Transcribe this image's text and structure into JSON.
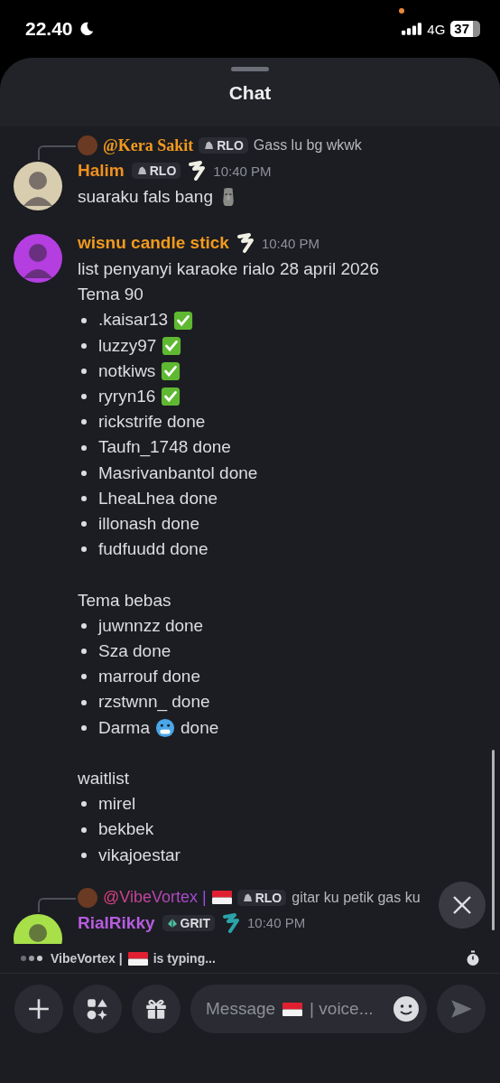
{
  "status_bar": {
    "time": "22.40",
    "network": "4G",
    "battery": "37"
  },
  "header": {
    "title": "Chat"
  },
  "messages": [
    {
      "reply": {
        "author": "@Kera Sakit",
        "flag": false,
        "tag": {
          "label": "RLO",
          "kind": "rock"
        },
        "text": "Gass lu bg wkwk"
      },
      "author": "Halim",
      "color": "#f0901e",
      "avatar": {
        "color": "#d9cdb0"
      },
      "tag": {
        "label": "RLO",
        "kind": "rock"
      },
      "badge": {
        "color": "#f0efe4"
      },
      "time": "10:40 PM",
      "body": [
        {
          "kind": "line",
          "text": "suaraku fals bang",
          "emoji": {
            "kind": "moai"
          }
        }
      ]
    },
    {
      "author": "wisnu candle stick",
      "color": "#f29a1d",
      "avatar": {
        "color": "#b43ee0"
      },
      "badge": {
        "color": "#f0efe4"
      },
      "time": "10:40 PM",
      "body": [
        {
          "kind": "line",
          "text": "list penyanyi karaoke rialo 28 april 2026"
        },
        {
          "kind": "line",
          "text": "Tema 90"
        },
        {
          "kind": "bullet",
          "text": ".kaisar13",
          "checked": true
        },
        {
          "kind": "bullet",
          "text": "luzzy97",
          "checked": true
        },
        {
          "kind": "bullet",
          "text": "notkiws",
          "checked": true
        },
        {
          "kind": "bullet",
          "text": "ryryn16",
          "checked": true
        },
        {
          "kind": "bullet",
          "text": "rickstrife  done",
          "checked": false
        },
        {
          "kind": "bullet",
          "text": "Taufn_1748  done",
          "checked": false
        },
        {
          "kind": "bullet",
          "text": "Masrivanbantol done",
          "checked": false
        },
        {
          "kind": "bullet",
          "text": "LheaLhea done",
          "checked": false
        },
        {
          "kind": "bullet",
          "text": "illonash done",
          "checked": false
        },
        {
          "kind": "bullet",
          "text": "fudfuudd done",
          "checked": false
        },
        {
          "kind": "gap"
        },
        {
          "kind": "line",
          "text": "Tema bebas"
        },
        {
          "kind": "bullet",
          "text": "juwnnzz done",
          "checked": false
        },
        {
          "kind": "bullet",
          "text": "Sza done",
          "checked": false
        },
        {
          "kind": "bullet",
          "text": "marrouf done",
          "checked": false
        },
        {
          "kind": "bullet",
          "text": "rzstwnn_ done",
          "checked": false
        },
        {
          "kind": "bullet",
          "text": "Darma",
          "emoji": {
            "kind": "cold"
          },
          "after": "done",
          "checked": false
        },
        {
          "kind": "gap"
        },
        {
          "kind": "line",
          "text": "waitlist"
        },
        {
          "kind": "bullet",
          "text": "mirel",
          "checked": false
        },
        {
          "kind": "bullet",
          "text": "bekbek",
          "checked": false
        },
        {
          "kind": "bullet",
          "text": "vikajoestar",
          "checked": false
        }
      ]
    },
    {
      "reply": {
        "author": "@VibeVortex |",
        "flag": true,
        "tag": {
          "label": "RLO",
          "kind": "rock"
        },
        "text": "gitar ku petik gas ku"
      },
      "author": "RialRikky",
      "color": "#b65ce0",
      "avatar": {
        "color": "#a8e04a"
      },
      "tag": {
        "label": "GRIT",
        "kind": "crystal"
      },
      "badge": {
        "color": "#2aa3a8"
      },
      "time": "10:40 PM"
    }
  ],
  "typing": {
    "user": "VibeVortex |",
    "flag": true,
    "text": "is typing..."
  },
  "composer": {
    "placeholder_start": "Message",
    "placeholder_end": "| voice..."
  }
}
